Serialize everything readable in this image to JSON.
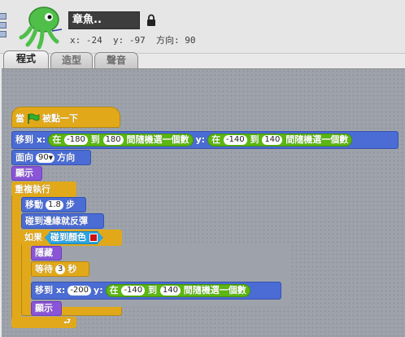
{
  "sprite": {
    "name": "章魚..",
    "info": "x: -24  y: -97  方向: 90"
  },
  "tabs": [
    {
      "label": "程式"
    },
    {
      "label": "造型"
    },
    {
      "label": "聲音"
    }
  ],
  "script": {
    "hat": {
      "label_before": "當",
      "label_after": "被點一下"
    },
    "goto": {
      "label": "移到 x:",
      "x_op": {
        "a": "在",
        "min": "-180",
        "to": "到",
        "max": "180",
        "tail": "間隨機選一個數"
      },
      "ylabel": "y:",
      "y_op": {
        "a": "在",
        "min": "-140",
        "to": "到",
        "max": "140",
        "tail": "間隨機選一個數"
      }
    },
    "point": {
      "label": "面向",
      "value": "90",
      "unit": "方向"
    },
    "show1": {
      "label": "顯示"
    },
    "forever": {
      "label": "重複執行"
    },
    "move": {
      "label": "移動",
      "value": "1.8",
      "unit": "步"
    },
    "bounce": {
      "label": "碰到邊緣就反彈"
    },
    "if": {
      "label": "如果",
      "cond": "碰到顏色",
      "color": "#cc1111"
    },
    "hide": {
      "label": "隱藏"
    },
    "wait": {
      "label": "等待",
      "value": "3",
      "unit": "秒"
    },
    "goto2": {
      "label": "移到 x:",
      "x": "-200",
      "ylabel": "y:",
      "y_op": {
        "a": "在",
        "min": "-140",
        "to": "到",
        "max": "140",
        "tail": "間隨機選一個數"
      }
    },
    "show2": {
      "label": "顯示"
    }
  },
  "colors": {
    "motion": "#4a6cd4",
    "looks": "#8a55d7",
    "control": "#e1a91a",
    "operator": "#5cb712",
    "sensing": "#2ca5e2",
    "flag": "#2fb12f"
  }
}
